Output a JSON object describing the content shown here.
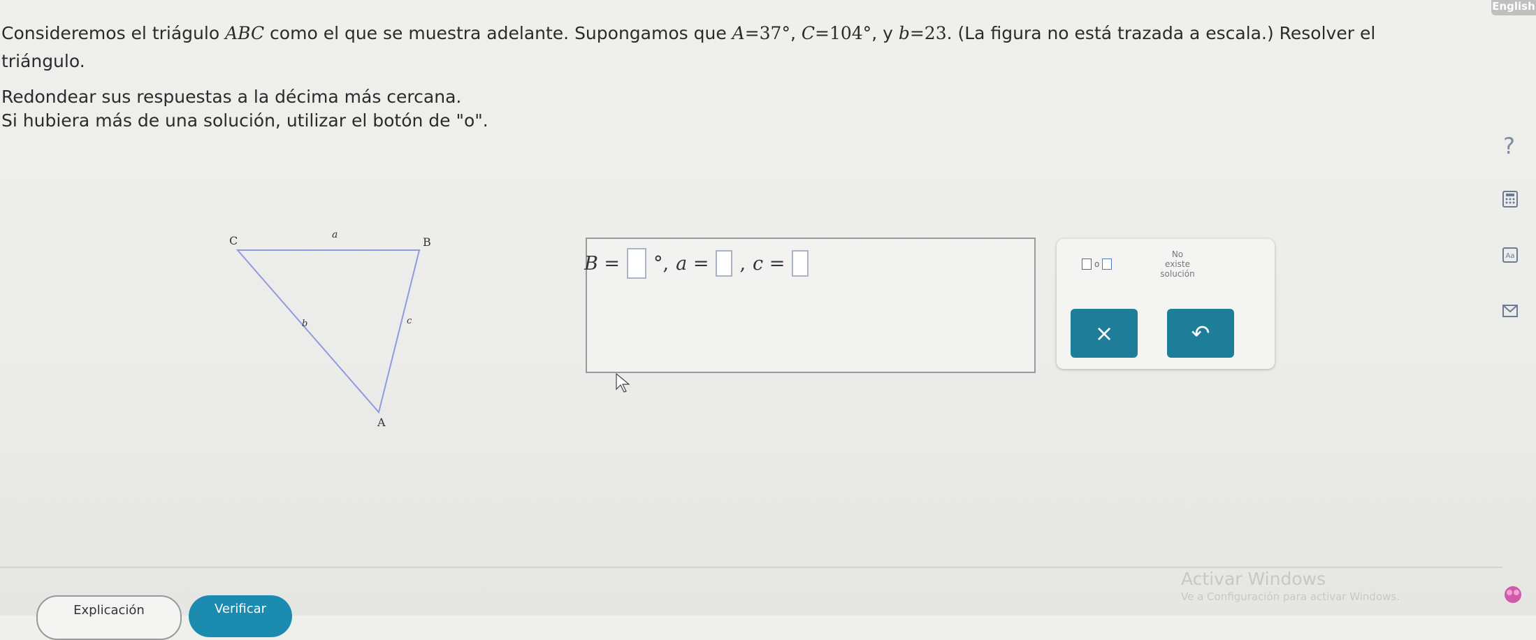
{
  "lang_tab": "English",
  "problem": {
    "p1": "Consideremos el triágulo ",
    "tri": "ABC",
    "p2": " como el que se muestra adelante. Supongamos que ",
    "A_sym": "A",
    "A_val": "=37°",
    "comma1": ", ",
    "C_sym": "C",
    "C_val": "=104°",
    "y": ", y ",
    "b_sym": "b",
    "b_val": "=23",
    "p3": ". (La figura no está trazada a escala.) Resolver el triángulo."
  },
  "instructions": {
    "line1": "Redondear sus respuestas a la décima más cercana.",
    "line2": "Si hubiera más de una solución, utilizar el botón de \"o\"."
  },
  "figure": {
    "C": "C",
    "B": "B",
    "A": "A",
    "a": "a",
    "b": "b",
    "c": "c"
  },
  "answer": {
    "B_label": "B =",
    "deg": "°,",
    "a_label": "a =",
    "sep2": ",",
    "c_label": "c ="
  },
  "pad": {
    "or": "o",
    "no_solution": [
      "No",
      "existe",
      "solución"
    ],
    "clear": "×",
    "undo": "↶"
  },
  "buttons": {
    "explanation": "Explicación",
    "verify": "Verificar"
  },
  "watermark": {
    "title": "Activar Windows",
    "subtitle": "Ve a Configuración para activar Windows."
  },
  "icons": [
    "help-icon",
    "calculator-icon",
    "glossary-icon",
    "mail-icon"
  ]
}
